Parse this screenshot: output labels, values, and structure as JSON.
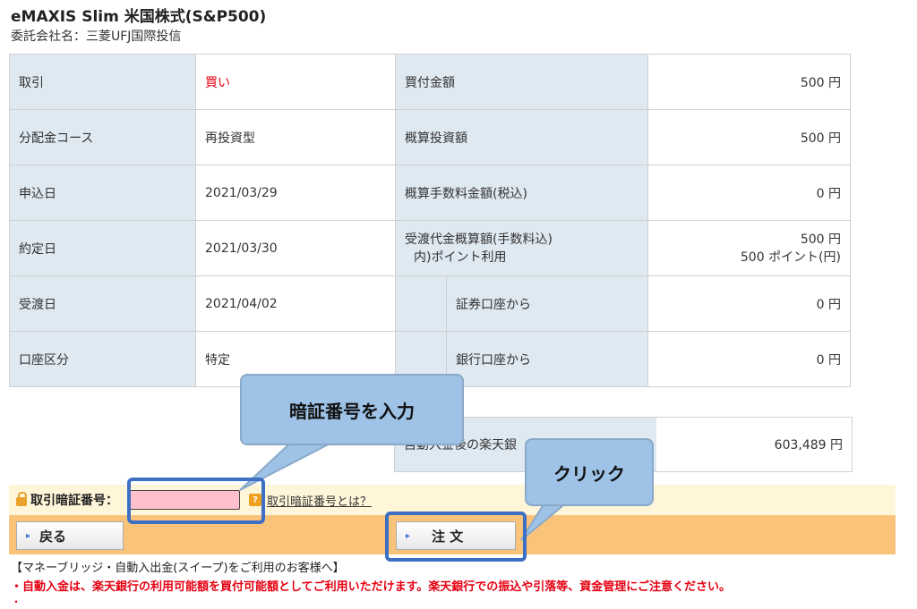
{
  "fund": {
    "title": "eMAXIS Slim 米国株式(S&P500)",
    "manager_label": "委託会社名：",
    "manager": "三菱UFJ国際投信"
  },
  "rows": {
    "trade_label": "取引",
    "trade_value": "買い",
    "buy_amount_label": "買付金額",
    "buy_amount": "500 円",
    "dist_label": "分配金コース",
    "dist_value": "再投資型",
    "est_invest_label": "概算投資額",
    "est_invest": "500 円",
    "apply_date_label": "申込日",
    "apply_date": "2021/03/29",
    "fee_label": "概算手数料金額(税込)",
    "fee": "0 円",
    "contract_date_label": "約定日",
    "contract_date": "2021/03/30",
    "settle_est_label": "受渡代金概算額(手数料込)",
    "settle_est": "500 円",
    "point_label": "内)ポイント利用",
    "point": "500 ポイント(円)",
    "delivery_date_label": "受渡日",
    "delivery_date": "2021/04/02",
    "sec_account_label": "証券口座から",
    "sec_account": "0 円",
    "account_type_label": "口座区分",
    "account_type": "特定",
    "bank_account_label": "銀行口座から",
    "bank_account": "0 円"
  },
  "balance": {
    "label": "自動入金後の楽天銀",
    "value": "603,489 円"
  },
  "pin": {
    "label": "取引暗証番号",
    "colon": "：",
    "help": "取引暗証番号とは？",
    "q": "?"
  },
  "buttons": {
    "back": "戻る",
    "order": "注 文",
    "arrow": "▸"
  },
  "notes": {
    "sweep_title": "【マネーブリッジ・自動入出金(スイープ)をご利用のお客様へ】",
    "notice": "・自動入金は、楽天銀行の利用可能額を買付可能額としてご利用いただけます。楽天銀行での振込や引落等、資金管理にご注意ください。",
    "notice2": "・"
  },
  "callouts": {
    "enter_pin": "暗証番号を入力",
    "click": "クリック"
  }
}
